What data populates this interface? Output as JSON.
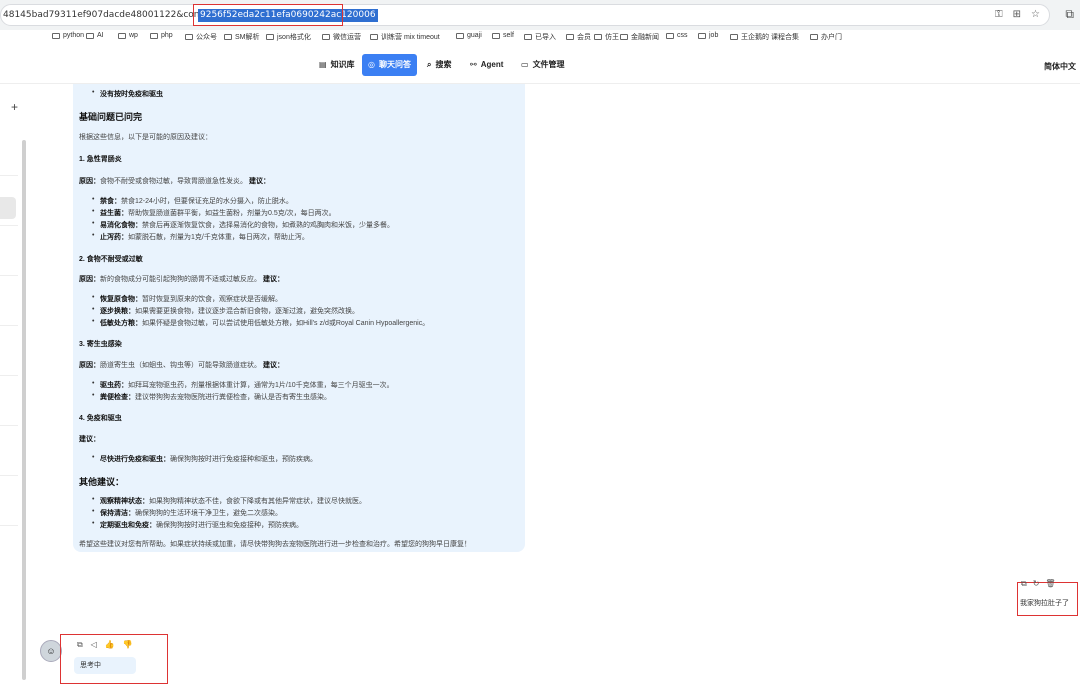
{
  "browser": {
    "url_prefix": "48145bad79311ef907dacde48001122&conversationId=",
    "url_selected": "9256f52eda2c11efa0690242ac120006",
    "bookmarks": [
      "python",
      "AI",
      "wp",
      "php",
      "公众号",
      "SM解析",
      "json格式化",
      "微信运营",
      "训练营 mix timeout",
      "guaji",
      "self",
      "已导入",
      "会员",
      "仿王",
      "金融新闻",
      "css",
      "job",
      "王企鹅的 课程合集",
      "办户门"
    ]
  },
  "nav": {
    "items": [
      {
        "label": "知识库",
        "icon": "book-icon"
      },
      {
        "label": "聊天问答",
        "icon": "chat-icon"
      },
      {
        "label": "搜索",
        "icon": "search-icon"
      },
      {
        "label": "Agent",
        "icon": "agent-icon"
      },
      {
        "label": "文件管理",
        "icon": "folder-icon"
      }
    ],
    "language": "简体中文"
  },
  "answer": {
    "top_bullet": "没有按时免疫和驱虫",
    "section1_title": "基础问题已问完",
    "intro": "根据这些信息，以下是可能的原因及建议：",
    "c1": {
      "title": "1. 急性胃肠炎",
      "cause_label": "原因：",
      "cause": "食物不耐受或食物过敏，导致胃肠道急性发炎。",
      "advice_label": "建议：",
      "items": [
        {
          "b": "禁食：",
          "t": "禁食12-24小时，但要保证充足的水分摄入，防止脱水。"
        },
        {
          "b": "益生菌：",
          "t": "帮助恢复肠道菌群平衡，如益生菌粉，剂量为0.5克/次，每日两次。"
        },
        {
          "b": "易消化食物：",
          "t": "禁食后再逐渐恢复饮食，选择易消化的食物，如煮熟的鸡胸肉和米饭，少量多餐。"
        },
        {
          "b": "止泻药：",
          "t": "如蒙脱石散，剂量为1克/千克体重，每日两次，帮助止泻。"
        }
      ]
    },
    "c2": {
      "title": "2. 食物不耐受或过敏",
      "cause_label": "原因：",
      "cause": "新的食物成分可能引起狗狗的肠胃不适或过敏反应。",
      "advice_label": "建议：",
      "items": [
        {
          "b": "恢复原食物：",
          "t": "暂时恢复到原来的饮食，观察症状是否缓解。"
        },
        {
          "b": "逐步换粮：",
          "t": "如果需要更换食物，建议逐步混合新旧食物，逐渐过渡，避免突然改换。"
        },
        {
          "b": "低敏处方粮：",
          "t": "如果怀疑是食物过敏，可以尝试使用低敏处方粮，如Hill's z/d或Royal Canin Hypoallergenic。"
        }
      ]
    },
    "c3": {
      "title": "3. 寄生虫感染",
      "cause_label": "原因：",
      "cause": "肠道寄生虫（如蛔虫、钩虫等）可能导致肠道症状。",
      "advice_label": "建议：",
      "items": [
        {
          "b": "驱虫药：",
          "t": "如拜耳宠物驱虫药，剂量根据体重计算，通常为1片/10千克体重，每三个月驱虫一次。"
        },
        {
          "b": "粪便检查：",
          "t": "建议带狗狗去宠物医院进行粪便检查，确认是否有寄生虫感染。"
        }
      ]
    },
    "c4": {
      "title": "4. 免疫和驱虫",
      "advice_label": "建议：",
      "items": [
        {
          "b": "尽快进行免疫和驱虫：",
          "t": "确保狗狗按时进行免疫接种和驱虫，预防疾病。"
        }
      ]
    },
    "other_title": "其他建议：",
    "other_items": [
      {
        "b": "观察精神状态：",
        "t": "如果狗狗精神状态不佳，食欲下降或有其他异常症状，建议尽快就医。"
      },
      {
        "b": "保持清洁：",
        "t": "确保狗狗的生活环境干净卫生，避免二次感染。"
      },
      {
        "b": "定期驱虫和免疫：",
        "t": "确保狗狗按时进行驱虫和免疫接种，预防疾病。"
      }
    ],
    "closing": "希望这些建议对您有所帮助。如果症状持续或加重，请尽快带狗狗去宠物医院进行进一步检查和治疗。希望您的狗狗早日康复！"
  },
  "user_message": "我家狗拉肚子了",
  "thinking": "思考中"
}
